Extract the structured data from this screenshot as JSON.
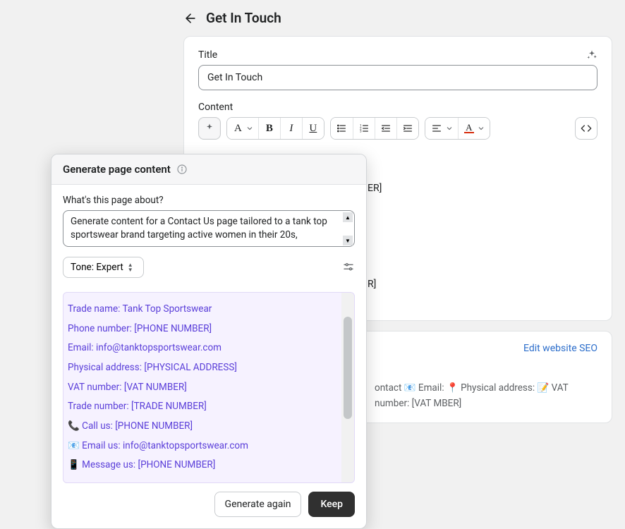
{
  "header": {
    "title": "Get In Touch"
  },
  "main": {
    "title_label": "Title",
    "title_value": "Get In Touch",
    "content_label": "Content",
    "toolbar": {
      "para": "A",
      "bold": "B",
      "italic": "I",
      "underline": "U"
    },
    "content": {
      "line1_placeholder": "ER]",
      "line2_placeholder": "R]"
    }
  },
  "seo": {
    "edit_link": "Edit website SEO",
    "preview_text": "ontact 📧 Email: 📍 Physical address: 📝 VAT number: [VAT MBER]"
  },
  "modal": {
    "title": "Generate page content",
    "prompt_label": "What's this page about?",
    "prompt_value": "Generate content for a Contact Us page tailored to a tank top sportswear brand targeting active women in their 20s,",
    "tone_label": "Tone: Expert",
    "generated": [
      "Trade name: Tank Top Sportswear",
      "Phone number: [PHONE NUMBER]",
      "Email: info@tanktopsportswear.com",
      "Physical address: [PHYSICAL ADDRESS]",
      "VAT number: [VAT NUMBER]",
      "Trade number: [TRADE NUMBER]",
      "📞 Call us: [PHONE NUMBER]",
      "📧 Email us: info@tanktopsportswear.com",
      "📱 Message us: [PHONE NUMBER]"
    ],
    "generate_again": "Generate again",
    "keep": "Keep"
  }
}
